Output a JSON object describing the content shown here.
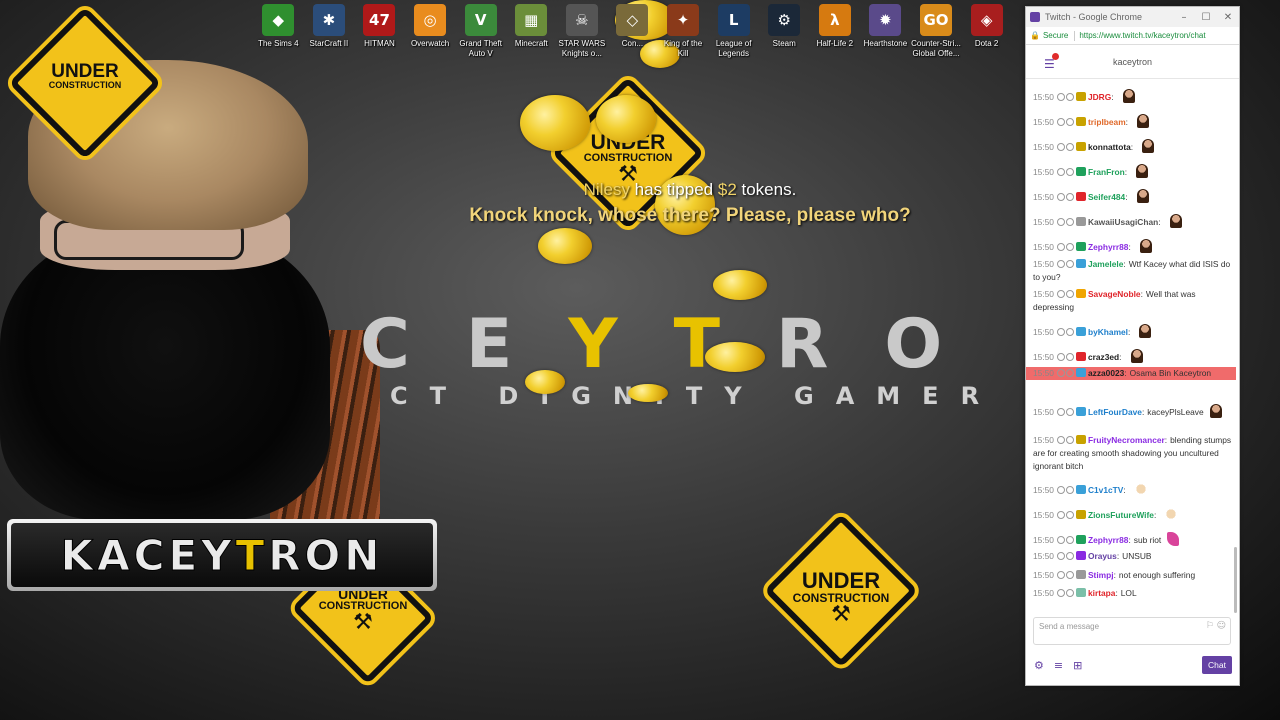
{
  "desktop_icons": [
    {
      "label": "The Sims 4",
      "glyph": "◆",
      "bg": "#2f8f2f"
    },
    {
      "label": "StarCraft II",
      "glyph": "✱",
      "bg": "#2b4d7a"
    },
    {
      "label": "HITMAN",
      "glyph": "47",
      "bg": "#b01919"
    },
    {
      "label": "Overwatch",
      "glyph": "◎",
      "bg": "#e98c1e"
    },
    {
      "label": "Grand Theft Auto V",
      "glyph": "V",
      "bg": "#3b8a3b"
    },
    {
      "label": "Minecraft",
      "glyph": "▦",
      "bg": "#6b8e3a"
    },
    {
      "label": "STAR WARS Knights o...",
      "glyph": "☠",
      "bg": "#555555"
    },
    {
      "label": "Con...",
      "glyph": "◇",
      "bg": "#7a6a3a"
    },
    {
      "label": "King of the Kill",
      "glyph": "✦",
      "bg": "#8a3a1a"
    },
    {
      "label": "League of Legends",
      "glyph": "L",
      "bg": "#1d3c63"
    },
    {
      "label": "Steam",
      "glyph": "⚙",
      "bg": "#1b2838"
    },
    {
      "label": "Half-Life 2",
      "glyph": "λ",
      "bg": "#d67a10"
    },
    {
      "label": "Hearthstone",
      "glyph": "✹",
      "bg": "#5a4a8a"
    },
    {
      "label": "Counter-Stri... Global Offe...",
      "glyph": "GO",
      "bg": "#d98b1a"
    },
    {
      "label": "Dota 2",
      "glyph": "◈",
      "bg": "#a81e1e"
    }
  ],
  "signs": {
    "big": "UNDER",
    "small": "CONSTRUCTION",
    "tools": "⚒"
  },
  "logo": {
    "letters_a": "C",
    "letters_b": "E",
    "letters_y": "Y",
    "letters_t": "T",
    "letters_r": "R",
    "letters_o": "O",
    "sub": "CT DIGNITY GAMER"
  },
  "alert": {
    "name": "Nilesy",
    "middle": " has tipped ",
    "amount": "$2",
    "end": " tokens.",
    "message": "Knock knock, whose there? Please, please who?"
  },
  "banner": {
    "part1": "KACEY",
    "part2": "T",
    "part3": "RON"
  },
  "chat": {
    "window_title": "Twitch - Google Chrome",
    "secure": "Secure",
    "url": "https://www.twitch.tv/kaceytron/chat",
    "channel": "kaceytron",
    "input_placeholder": "Send a message",
    "chat_button": "Chat",
    "messages": [
      {
        "time": "15:50",
        "user": "JDRG",
        "color": "#e0252b",
        "badge": "#c8a200",
        "text": "",
        "emote": "person"
      },
      {
        "time": "15:50",
        "user": "tripIbeam",
        "color": "#e06a2b",
        "badge": "#c8a200",
        "text": "",
        "emote": "person"
      },
      {
        "time": "15:50",
        "user": "konnattota",
        "color": "#222222",
        "badge": "#c8a200",
        "text": "",
        "emote": "person"
      },
      {
        "time": "15:50",
        "user": "FranFron",
        "color": "#1fa15c",
        "badge": "#1fa15c",
        "text": "",
        "emote": "person"
      },
      {
        "time": "15:50",
        "user": "Seifer484",
        "color": "#1fa15c",
        "badge": "#e0252b",
        "text": "",
        "emote": "person"
      },
      {
        "time": "15:50",
        "user": "KawaiiUsagiChan",
        "color": "#555555",
        "badge": "#999999",
        "text": "",
        "emote": "person"
      },
      {
        "time": "15:50",
        "user": "Zephyrr88",
        "color": "#8a2be2",
        "badge": "#1fa15c",
        "text": "",
        "emote": "person"
      },
      {
        "time": "15:50",
        "user": "Jamelele",
        "color": "#1fa15c",
        "badge": "#3aa0d8",
        "text": "Wtf Kacey what did ISIS do to you?",
        "emote": ""
      },
      {
        "time": "15:50",
        "user": "SavageNoble",
        "color": "#e0252b",
        "badge": "#f0a500",
        "text": "Well that was depressing",
        "emote": ""
      },
      {
        "time": "15:50",
        "user": "byKhamel",
        "color": "#1e7fcb",
        "badge": "#3aa0d8",
        "text": "",
        "emote": "face"
      },
      {
        "time": "15:50",
        "user": "craz3ed",
        "color": "#222222",
        "badge": "#e0252b",
        "text": "",
        "emote": "person"
      },
      {
        "time": "15:50",
        "user": "azza0023",
        "color": "#222222",
        "badge": "#3aa0d8",
        "text": "Osama Bin Kaceytron",
        "emote": "",
        "highlight": true
      },
      {
        "time": "15:50",
        "user": "LeftFourDave",
        "color": "#1e7fcb",
        "badge": "#3aa0d8",
        "text": "kaceyPlsLeave",
        "emote": "person"
      },
      {
        "time": "15:50",
        "user": "FruityNecromancer",
        "color": "#8a2be2",
        "badge": "#c8a200",
        "text": "blending stumps are for creating smooth shadowing you uncultured ignorant bitch",
        "emote": ""
      },
      {
        "time": "15:50",
        "user": "C1v1cTV",
        "color": "#1e7fcb",
        "badge": "#3aa0d8",
        "text": "",
        "emote": "face2"
      },
      {
        "time": "15:50",
        "user": "ZionsFutureWife",
        "color": "#1fa15c",
        "badge": "#c8a200",
        "text": "",
        "emote": "face2"
      },
      {
        "time": "15:50",
        "user": "Zephyrr88",
        "color": "#8a2be2",
        "badge": "#1fa15c",
        "text": "sub riot",
        "emote": "pen"
      },
      {
        "time": "15:50",
        "user": "Orayus",
        "color": "#6441a4",
        "badge": "#8a2be2",
        "text": "UNSUB",
        "emote": ""
      },
      {
        "time": "15:50",
        "user": "Stimpj",
        "color": "#8a2be2",
        "badge": "#999999",
        "text": "not enough suffering",
        "emote": ""
      },
      {
        "time": "15:50",
        "user": "kirtapa",
        "color": "#e0252b",
        "badge": "#7bbfa8",
        "text": "LOL",
        "emote": ""
      }
    ]
  }
}
